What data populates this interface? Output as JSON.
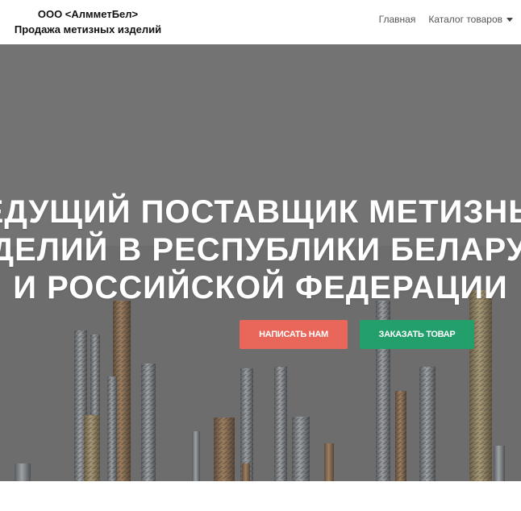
{
  "navbar": {
    "brand_line1": "ООО <АлмметБел>",
    "brand_line2": "Продажа метизных изделий",
    "links": [
      {
        "label": "Главная"
      },
      {
        "label": "Каталог товаров",
        "dropdown": true
      }
    ]
  },
  "hero": {
    "title": "ВЕДУЩИЙ ПОСТАВЩИК МЕТИЗНЫХ\nИЗДЕЛИЙ В РЕСПУБЛИКИ БЕЛАРУСЬ\nИ РОССИЙСКОЙ ФЕДЕРАЦИИ",
    "background": "screws-photo",
    "buttons": {
      "write_label": "НАПИСАТЬ НАМ",
      "order_label": "ЗАКАЗАТЬ ТОВАР"
    }
  },
  "colors": {
    "write_button": "#e8665a",
    "order_button": "#239f6b",
    "hero_overlay": "#7a7a7a"
  }
}
